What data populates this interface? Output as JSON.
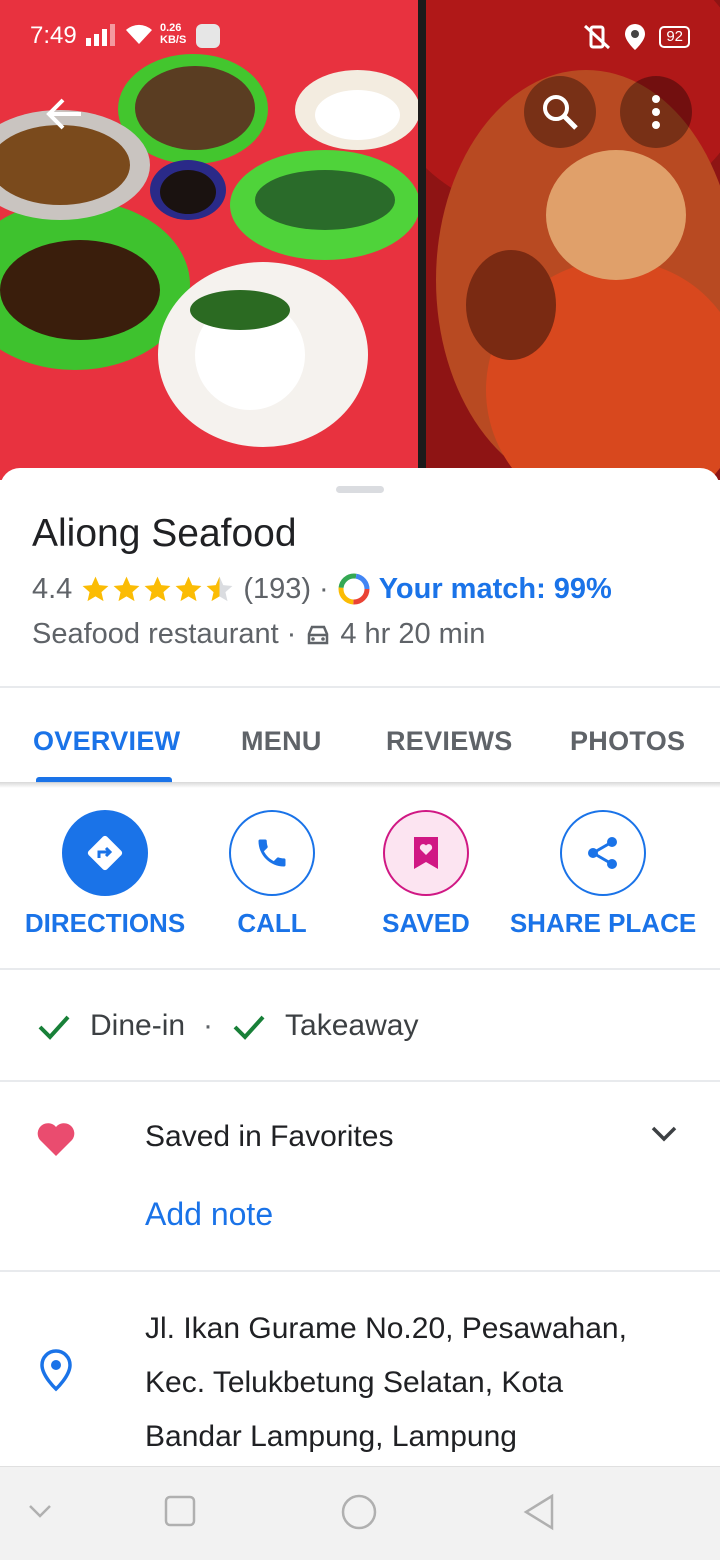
{
  "status_bar": {
    "time": "7:49",
    "speed_value": "0.26",
    "speed_unit": "KB/S",
    "battery": "92"
  },
  "header": {
    "back_icon": "arrow-left-icon",
    "search_icon": "search-icon",
    "more_icon": "more-vert-icon"
  },
  "place": {
    "name": "Aliong Seafood",
    "rating": "4.4",
    "stars_filled": 4.4,
    "reviews_count": "(193)",
    "separator": "·",
    "match_text": "Your match: 99%",
    "category": "Seafood restaurant",
    "drive_time": "4 hr 20 min"
  },
  "tabs": [
    {
      "label": "OVERVIEW",
      "active": true
    },
    {
      "label": "MENU",
      "active": false
    },
    {
      "label": "REVIEWS",
      "active": false
    },
    {
      "label": "PHOTOS",
      "active": false
    }
  ],
  "actions": [
    {
      "label": "DIRECTIONS",
      "icon": "directions-icon"
    },
    {
      "label": "CALL",
      "icon": "phone-icon"
    },
    {
      "label": "SAVED",
      "icon": "bookmark-heart-icon"
    },
    {
      "label": "SHARE PLACE",
      "icon": "share-icon"
    }
  ],
  "services": [
    {
      "label": "Dine-in"
    },
    {
      "label": "Takeaway"
    }
  ],
  "favorites": {
    "label": "Saved in Favorites",
    "add_note": "Add note"
  },
  "address": {
    "lines": [
      "Jl. Ikan Gurame No.20, Pesawahan,",
      "Kec. Telukbetung Selatan, Kota",
      "Bandar Lampung, Lampung"
    ]
  },
  "colors": {
    "accent": "#1a73e8",
    "star": "#fbbc04",
    "saved": "#d01884",
    "check": "#188038",
    "heart": "#ea4c6f"
  }
}
